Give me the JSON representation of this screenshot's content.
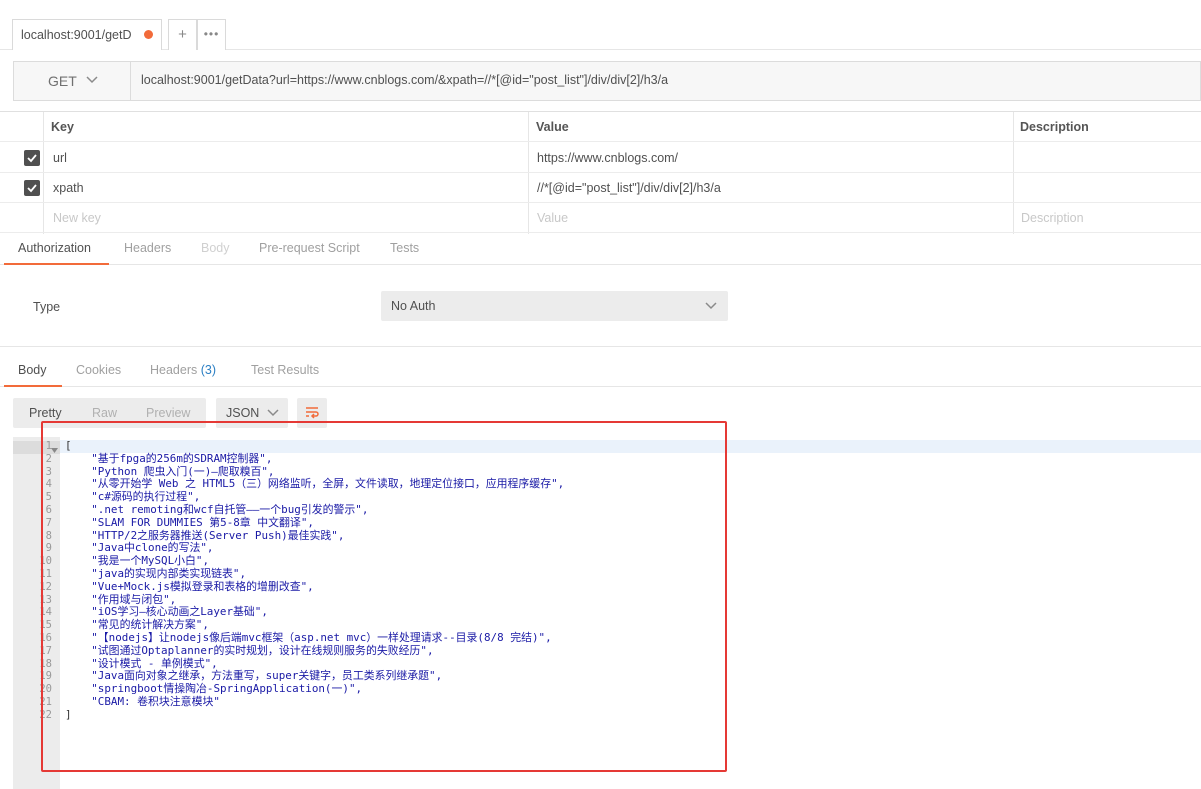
{
  "tabs": [
    {
      "label": "localhost:9001/getD",
      "unsaved": true
    }
  ],
  "tab_add_label": "+",
  "tab_more_label": "•••",
  "request": {
    "method": "GET",
    "url": "localhost:9001/getData?url=https://www.cnblogs.com/&xpath=//*[@id=\"post_list\"]/div/div[2]/h3/a"
  },
  "params": {
    "headers": {
      "key": "Key",
      "value": "Value",
      "description": "Description"
    },
    "rows": [
      {
        "key": "url",
        "value": "https://www.cnblogs.com/",
        "checked": true
      },
      {
        "key": "xpath",
        "value": "//*[@id=\"post_list\"]/div/div[2]/h3/a",
        "checked": true
      }
    ],
    "placeholders": {
      "key": "New key",
      "value": "Value",
      "description": "Description"
    }
  },
  "request_tabs": [
    "Authorization",
    "Headers",
    "Body",
    "Pre-request Script",
    "Tests"
  ],
  "auth": {
    "type_label": "Type",
    "selected": "No Auth"
  },
  "response_tabs": {
    "body": "Body",
    "cookies": "Cookies",
    "headers": "Headers",
    "headers_count": "(3)",
    "tests": "Test Results"
  },
  "view_modes": [
    "Pretty",
    "Raw",
    "Preview"
  ],
  "format": "JSON",
  "response_lines": [
    "[",
    "    \"基于fpga的256m的SDRAM控制器\",",
    "    \"Python 爬虫入门(一)—爬取糗百\",",
    "    \"从零开始学 Web 之 HTML5（三）网络监听，全屏，文件读取，地理定位接口，应用程序缓存\",",
    "    \"c#源码的执行过程\",",
    "    \".net remoting和wcf自托管——一个bug引发的警示\",",
    "    \"SLAM FOR DUMMIES 第5-8章 中文翻译\",",
    "    \"HTTP/2之服务器推送(Server Push)最佳实践\",",
    "    \"Java中clone的写法\",",
    "    \"我是一个MySQL小白\",",
    "    \"java的实现内部类实现链表\",",
    "    \"Vue+Mock.js模拟登录和表格的增删改查\",",
    "    \"作用域与闭包\",",
    "    \"iOS学习—核心动画之Layer基础\",",
    "    \"常见的统计解决方案\",",
    "    \"【nodejs】让nodejs像后端mvc框架（asp.net mvc）一样处理请求--目录(8/8 完结)\",",
    "    \"试图通过Optaplanner的实时规划，设计在线规则服务的失败经历\",",
    "    \"设计模式 - 单例模式\",",
    "    \"Java面向对象之继承，方法重写，super关键字，员工类系列继承题\",",
    "    \"springboot情操陶冶-SpringApplication(一)\",",
    "    \"CBAM: 卷积块注意模块\"",
    "]"
  ],
  "colors": {
    "accent": "#f26b3a",
    "string": "#1a1aa6",
    "highlight": "#e53935"
  }
}
